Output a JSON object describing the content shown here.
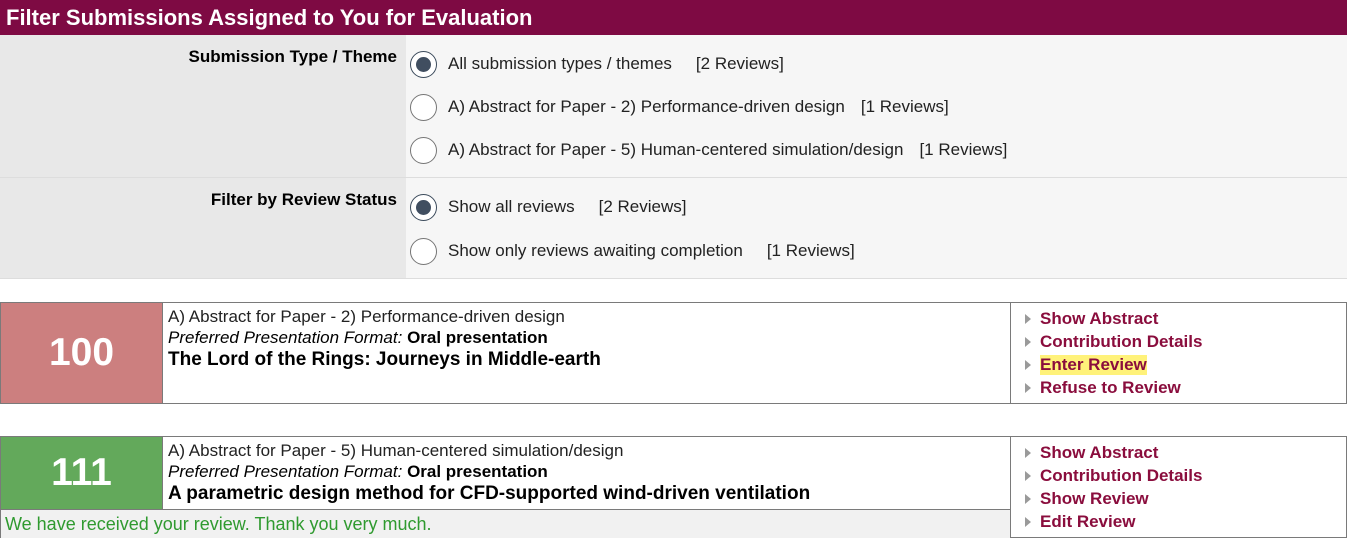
{
  "header": {
    "title": "Filter Submissions Assigned to You for Evaluation"
  },
  "filters": {
    "type": {
      "label": "Submission Type / Theme",
      "options": [
        {
          "label": "All submission types / themes",
          "count": "[2 Reviews]",
          "checked": true
        },
        {
          "label": "A) Abstract for Paper - 2) Performance-driven design",
          "count": "[1 Reviews]",
          "checked": false
        },
        {
          "label": "A) Abstract for Paper - 5) Human-centered simulation/design",
          "count": "[1 Reviews]",
          "checked": false
        }
      ]
    },
    "status": {
      "label": "Filter by Review Status",
      "options": [
        {
          "label": "Show all reviews",
          "count": "[2 Reviews]",
          "checked": true
        },
        {
          "label": "Show only reviews awaiting completion",
          "count": "[1 Reviews]",
          "checked": false
        }
      ]
    }
  },
  "submissions": [
    {
      "number": "100",
      "type": "A) Abstract for Paper - 2) Performance-driven design",
      "format_label": "Preferred Presentation Format:",
      "format_value": "Oral presentation",
      "title": "The Lord of the Rings: Journeys in Middle-earth",
      "status_color": "#cc7f7f",
      "actions": [
        "Show Abstract",
        "Contribution Details",
        "Enter Review",
        "Refuse to Review"
      ]
    },
    {
      "number": "111",
      "type": "A) Abstract for Paper - 5) Human-centered simulation/design",
      "format_label": "Preferred Presentation Format:",
      "format_value": "Oral presentation",
      "title": "A parametric design method for CFD-supported wind-driven ventilation",
      "status_color": "#63a95b",
      "received_message": "We have received your review. Thank you very much.",
      "actions": [
        "Show Abstract",
        "Contribution Details",
        "Show Review",
        "Edit Review"
      ]
    }
  ],
  "colors": {
    "header_bg": "#7e0a43",
    "action_link": "#8a0d3d",
    "highlight": "#fff27a",
    "success_text": "#2f9a2f"
  },
  "icons": {
    "radio": "radio-button",
    "action_bullet": "triangle-right-icon"
  }
}
